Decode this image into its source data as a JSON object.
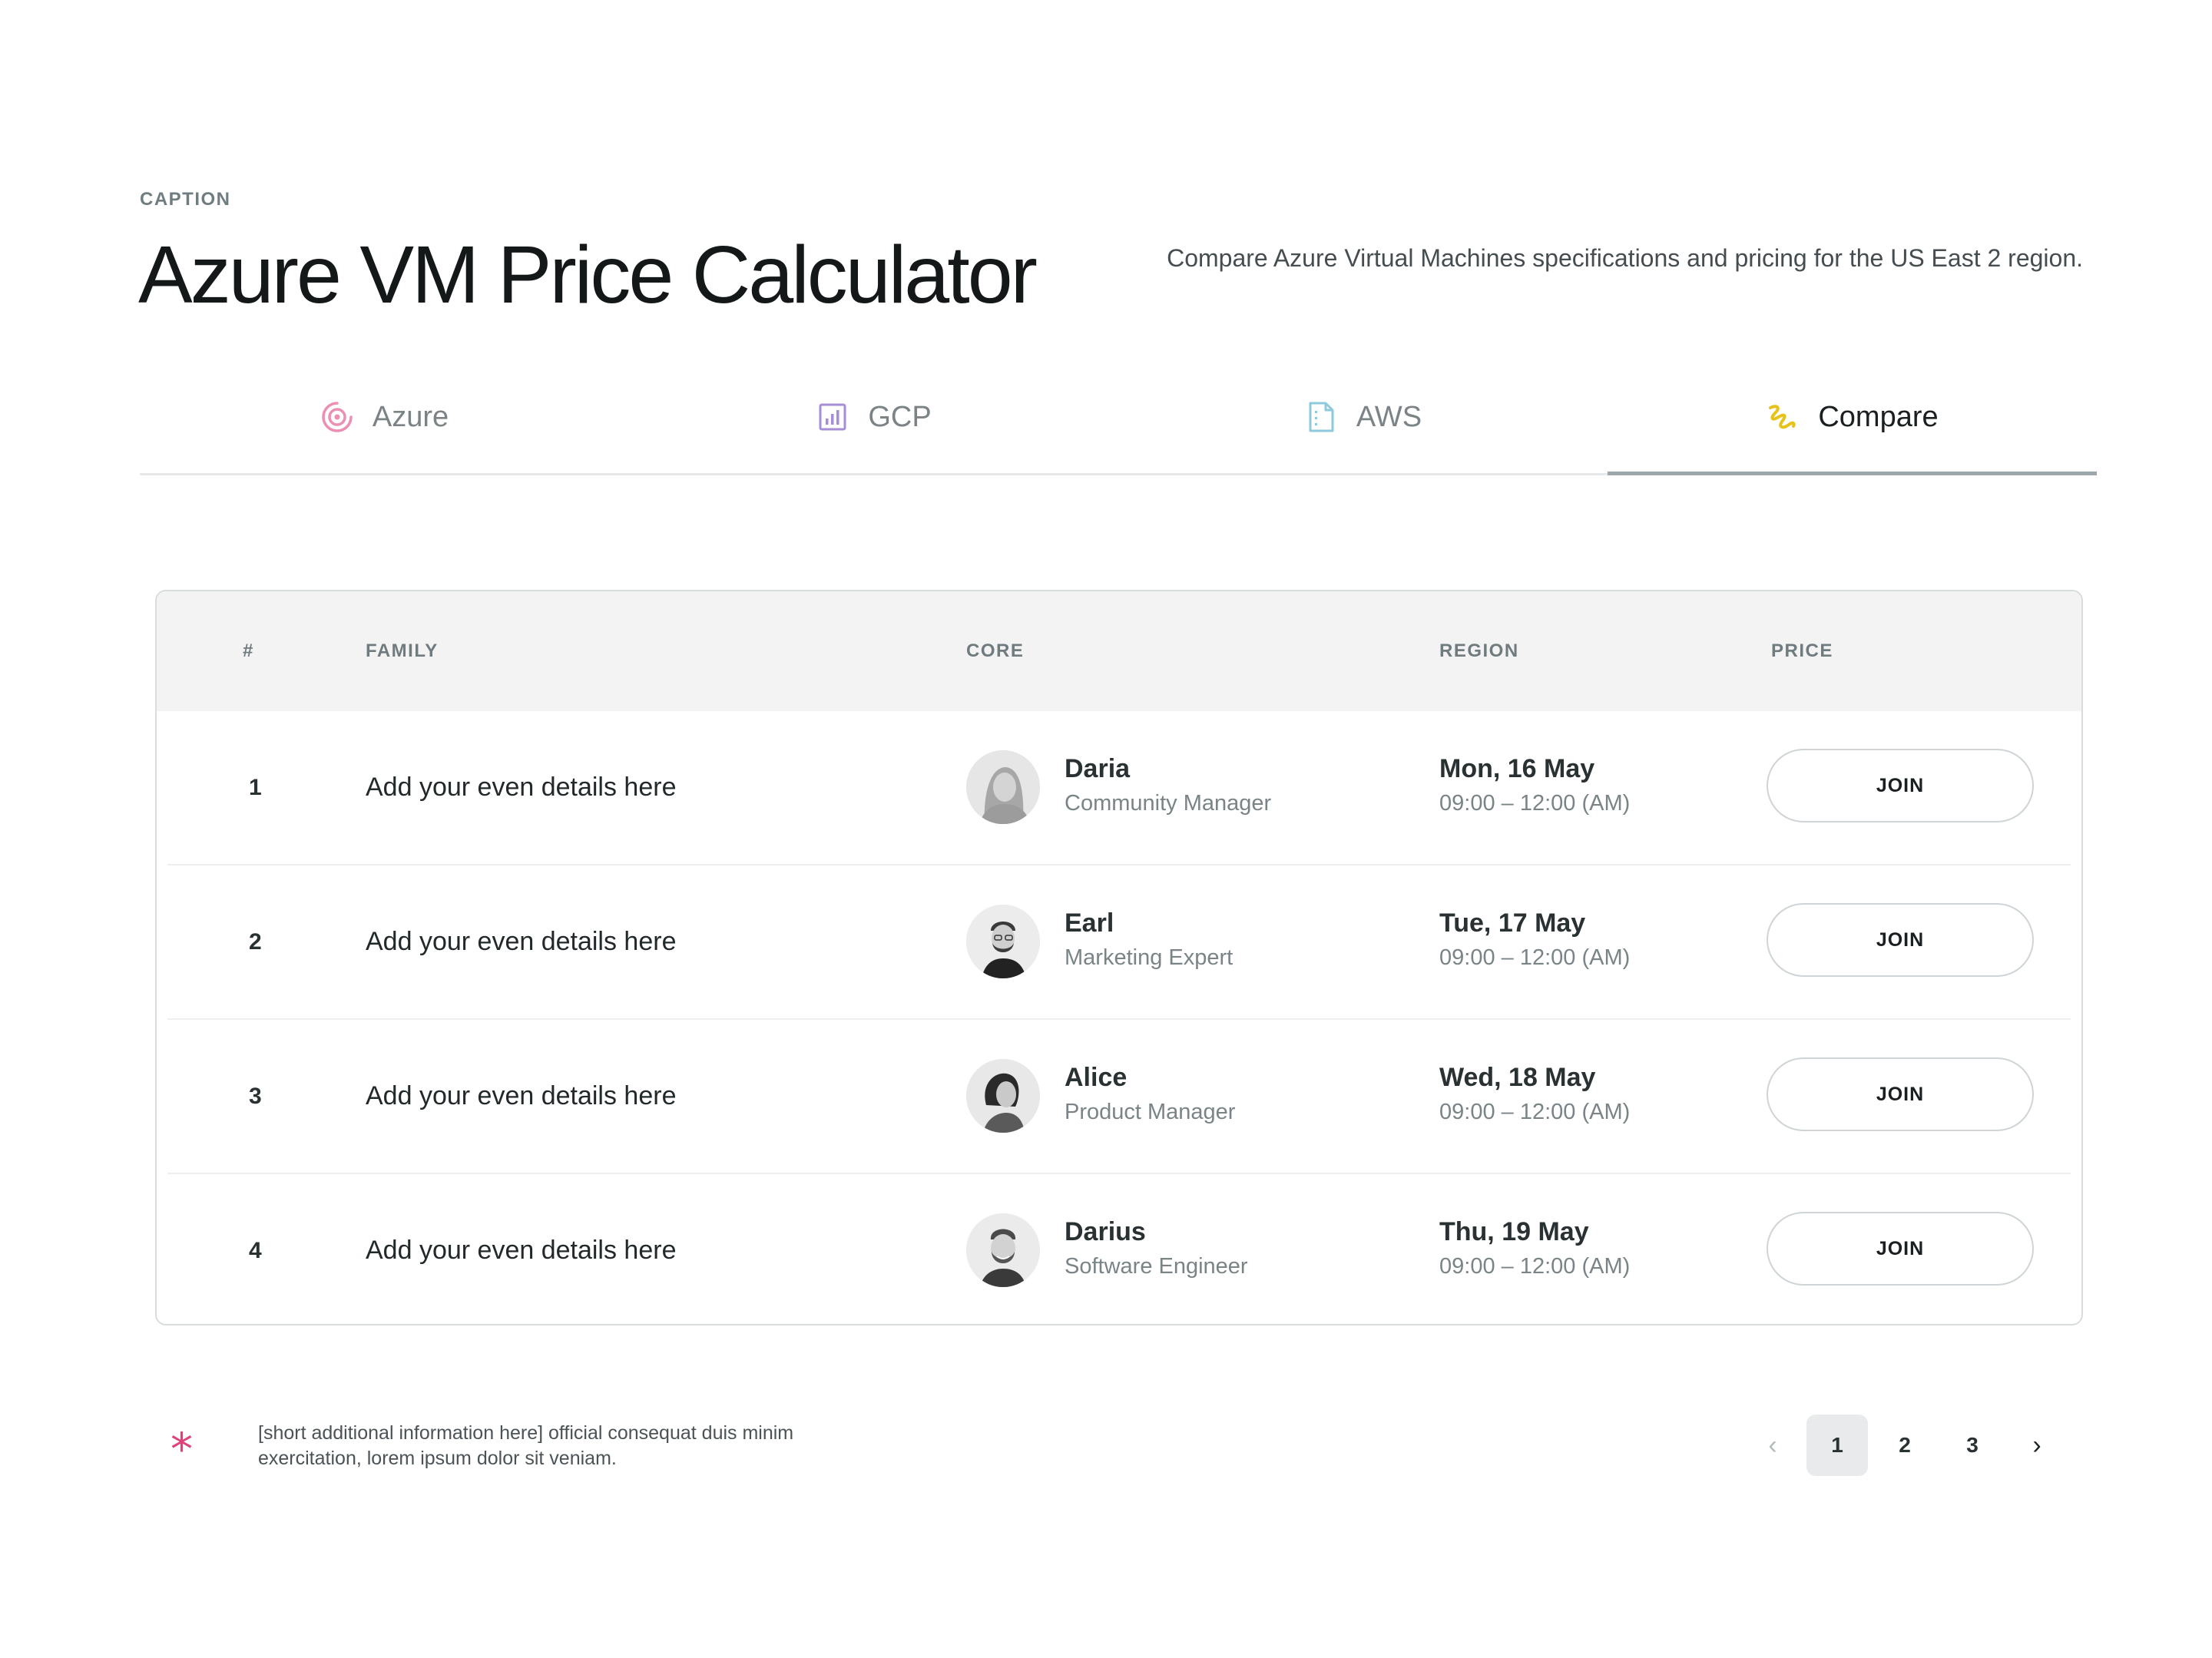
{
  "header": {
    "caption": "CAPTION",
    "title": "Azure VM Price Calculator",
    "description": "Compare Azure Virtual Machines specifications and pricing for the US East 2 region."
  },
  "tabs": [
    {
      "label": "Azure",
      "icon": "target-icon",
      "color": "#ec8fb3",
      "active": false
    },
    {
      "label": "GCP",
      "icon": "bar-chart-icon",
      "color": "#a68dd6",
      "active": false
    },
    {
      "label": "AWS",
      "icon": "document-icon",
      "color": "#8ec9dd",
      "active": false
    },
    {
      "label": "Compare",
      "icon": "squiggle-icon",
      "color": "#e7c31a",
      "active": true
    }
  ],
  "table": {
    "columns": [
      "#",
      "FAMILY",
      "CORE",
      "REGION",
      "PRICE"
    ],
    "rows": [
      {
        "num": "1",
        "family": "Add your even details here",
        "name": "Daria",
        "role": "Community Manager",
        "date": "Mon, 16 May",
        "time": "09:00 – 12:00 (AM)",
        "action": "JOIN"
      },
      {
        "num": "2",
        "family": "Add your even details here",
        "name": "Earl",
        "role": "Marketing Expert",
        "date": "Tue, 17 May",
        "time": "09:00 – 12:00 (AM)",
        "action": "JOIN"
      },
      {
        "num": "3",
        "family": "Add your even details here",
        "name": "Alice",
        "role": "Product Manager",
        "date": "Wed, 18 May",
        "time": "09:00 – 12:00 (AM)",
        "action": "JOIN"
      },
      {
        "num": "4",
        "family": "Add your even details here",
        "name": "Darius",
        "role": "Software Engineer",
        "date": "Thu, 19 May",
        "time": "09:00 – 12:00 (AM)",
        "action": "JOIN"
      }
    ]
  },
  "footer": {
    "asterisk": "*",
    "note": "[short additional information here] official consequat duis minim exercitation, lorem ipsum dolor sit veniam.",
    "accent": "#e0417a"
  },
  "pagination": {
    "prev": "‹",
    "next": "›",
    "pages": [
      "1",
      "2",
      "3"
    ],
    "current": "1"
  }
}
